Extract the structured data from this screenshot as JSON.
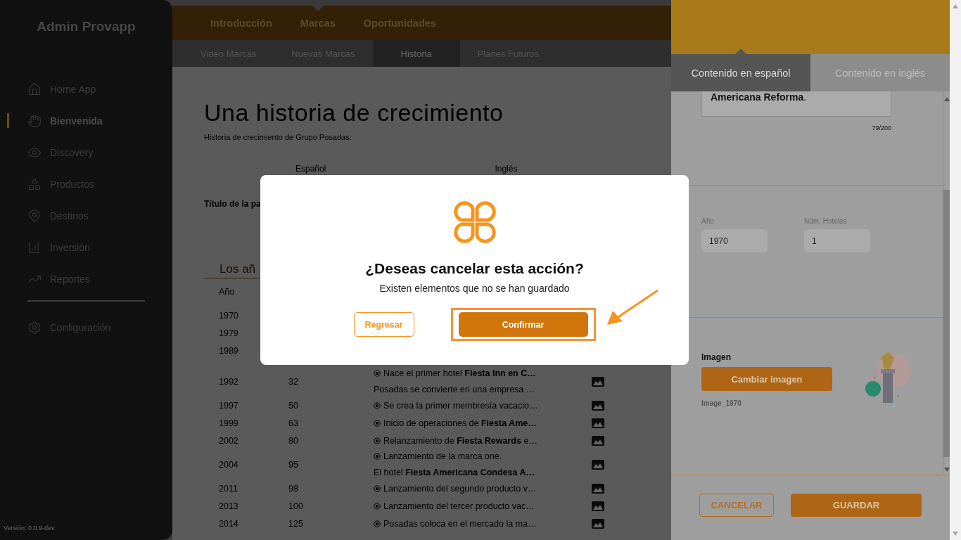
{
  "sidebar": {
    "title": "Admin Provapp",
    "items": [
      {
        "label": "Home App",
        "selected": false
      },
      {
        "label": "Bienvenida",
        "selected": true
      },
      {
        "label": "Discovery",
        "selected": false
      },
      {
        "label": "Productos",
        "selected": false
      },
      {
        "label": "Destinos",
        "selected": false
      },
      {
        "label": "Inversión",
        "selected": false
      },
      {
        "label": "Reportes",
        "selected": false
      }
    ],
    "settings": {
      "label": "Configuración"
    },
    "version": "Versión: 0.0.9-dev"
  },
  "main": {
    "tabs": [
      {
        "label": "Introducción",
        "selected": false
      },
      {
        "label": "Marcas",
        "selected": true
      },
      {
        "label": "Oportunidades",
        "selected": false
      }
    ],
    "subtabs": [
      {
        "label": "Video Marcas",
        "selected": false
      },
      {
        "label": "Nuevas Marcas",
        "selected": false
      },
      {
        "label": "Historia",
        "selected": true
      },
      {
        "label": "Planes Futuros",
        "selected": false
      }
    ],
    "title": "Una historia de crecimiento",
    "subtitle": "Historia de crecimiento de Grupo Posadas.",
    "language_headers": [
      "Español",
      "Inglés"
    ],
    "field_label": "Título de la pa",
    "section_title": "Los añ",
    "table": {
      "columns": [
        "Año"
      ],
      "rows": [
        {
          "year": "1970"
        },
        {
          "year": "1979"
        },
        {
          "year": "1989"
        },
        {
          "year": "1992",
          "hotels": "32",
          "lines": [
            {
              "bullet": true,
              "text": "Nace el primer hotel **Fiesta Inn en C…**"
            },
            {
              "text": "Posadas se convierte en una empresa …"
            }
          ],
          "image": true
        },
        {
          "year": "1997",
          "hotels": "50",
          "lines": [
            {
              "bullet": true,
              "text": "Se crea la primer membresía vacacio…"
            }
          ],
          "image": true
        },
        {
          "year": "1999",
          "hotels": "63",
          "lines": [
            {
              "bullet": true,
              "text": "Inicio de operaciones de **Fiesta Ame…**"
            }
          ],
          "image": true
        },
        {
          "year": "2002",
          "hotels": "80",
          "lines": [
            {
              "bullet": true,
              "text": "Relanzamiento de **Fiesta Rewards** e…"
            }
          ],
          "image": true
        },
        {
          "year": "2004",
          "hotels": "95",
          "lines": [
            {
              "bullet": true,
              "text": "Lanzamiento de la marca one."
            },
            {
              "text": "El hotel **Fiesta Americana Condesa A…**"
            }
          ],
          "image": true
        },
        {
          "year": "2011",
          "hotels": "98",
          "lines": [
            {
              "bullet": true,
              "text": "Lanzamiento del segundo producto v…"
            }
          ],
          "image": true
        },
        {
          "year": "2013",
          "hotels": "100",
          "lines": [
            {
              "bullet": true,
              "text": "Lanzamiento del tercer producto vac…"
            }
          ],
          "image": true
        },
        {
          "year": "2014",
          "hotels": "125",
          "lines": [
            {
              "bullet": true,
              "text": "Posadas coloca en el mercado la ma…"
            }
          ],
          "image": true
        }
      ]
    }
  },
  "drawer": {
    "tabs": [
      {
        "label": "Contenido en español",
        "selected": true
      },
      {
        "label": "Contenido en inglés",
        "selected": false
      }
    ],
    "textarea": {
      "value": "**Americana Reforma**."
    },
    "counter": "79/200",
    "fields": [
      {
        "label": "Año",
        "value": "1970"
      },
      {
        "label": "Núm. Hoteles",
        "value": "1"
      }
    ],
    "image": {
      "label": "Imagen",
      "button": "Cambiar imagen",
      "filename": "Image_1970",
      "kind": "picture"
    },
    "buttons": [
      {
        "label": "CANCELAR",
        "kind": "outline"
      },
      {
        "label": "GUARDAR",
        "kind": "primary"
      }
    ]
  },
  "dialog": {
    "title": "¿Deseas cancelar esta acción?",
    "message": "Existen elementos que no se han guardado",
    "buttons": [
      {
        "label": "Regresar",
        "kind": "outline",
        "highlighted": false
      },
      {
        "label": "Confirmar",
        "kind": "primary",
        "highlighted": true
      }
    ]
  }
}
